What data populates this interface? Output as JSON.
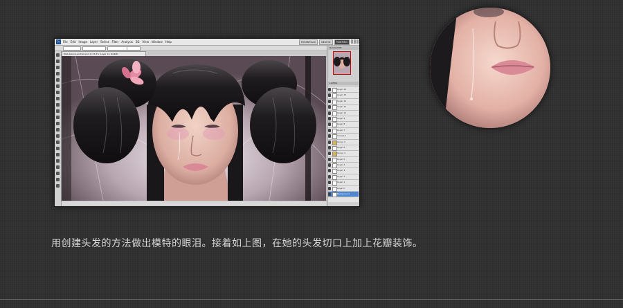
{
  "photoshop": {
    "logo": "Ps",
    "menu": [
      "File",
      "Edit",
      "Image",
      "Layer",
      "Select",
      "Filter",
      "Analysis",
      "3D",
      "View",
      "Window",
      "Help"
    ],
    "workspaces": [
      "ESSENTIALS",
      "DESIGN",
      "PAINTING"
    ],
    "document_tab": "Web-Sakura-portrait.psd @ 33.3% (Layer 13, RGB/8)",
    "panels": {
      "navigator_tab": "NAVIGATOR",
      "layers_tab": "LAYERS"
    },
    "layers": [
      {
        "name": "Layer 14",
        "type": "layer"
      },
      {
        "name": "Layer 13",
        "type": "layer"
      },
      {
        "name": "Layer 12",
        "type": "layer"
      },
      {
        "name": "Layer 11",
        "type": "layer"
      },
      {
        "name": "Layer 10",
        "type": "layer"
      },
      {
        "name": "Layer 9",
        "type": "layer"
      },
      {
        "name": "Layer 8",
        "type": "layer"
      },
      {
        "name": "Layer 7",
        "type": "layer"
      },
      {
        "name": "Curves 1",
        "type": "layer"
      },
      {
        "name": "Group 2",
        "type": "group"
      },
      {
        "name": "Layer 6",
        "type": "layer"
      },
      {
        "name": "Group 1",
        "type": "group"
      },
      {
        "name": "Layer 5",
        "type": "layer"
      },
      {
        "name": "Layer 4",
        "type": "layer"
      },
      {
        "name": "Layer 3",
        "type": "layer"
      },
      {
        "name": "Layer 2",
        "type": "layer"
      },
      {
        "name": "Layer 1",
        "type": "layer"
      },
      {
        "name": "Layer 0",
        "type": "layer"
      },
      {
        "name": "Background",
        "type": "layer",
        "selected": true
      }
    ]
  },
  "caption": "用创建头发的方法做出模特的眼泪。接着如上图，在她的头发切口上加上花瓣装饰。",
  "colors": {
    "background": "#2f2f2f",
    "caption": "#d6d6d6",
    "hair": "#1c1a1d",
    "skin": "#e7c0b3",
    "lips": "#d98a96",
    "flower": "#e68aa3",
    "selected_layer": "#4f86cf"
  }
}
